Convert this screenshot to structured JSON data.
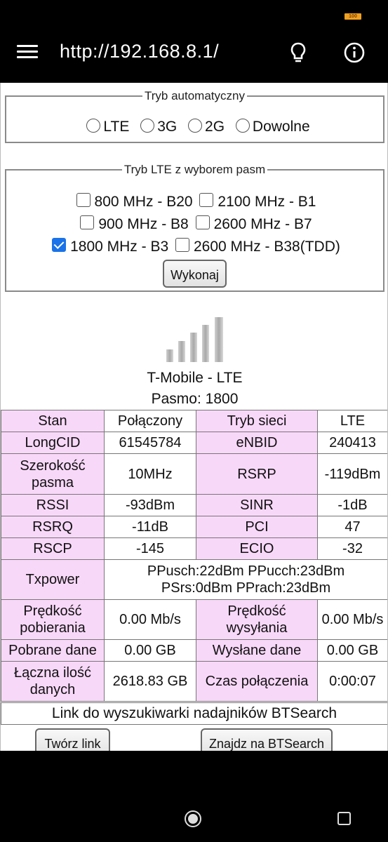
{
  "status_bar": {
    "battery_label": "100"
  },
  "toolbar": {
    "url": "http://192.168.8.1/",
    "menu_icon": "hamburger-menu-icon",
    "bulb_icon": "lightbulb-icon",
    "info_icon": "info-icon"
  },
  "auto_mode": {
    "legend": "Tryb automatyczny",
    "options": [
      "LTE",
      "3G",
      "2G",
      "Dowolne"
    ]
  },
  "lte_bands": {
    "legend": "Tryb LTE z wyborem pasm",
    "rows": [
      [
        {
          "label": "800 MHz - B20",
          "checked": false
        },
        {
          "label": "2100 MHz - B1",
          "checked": false
        }
      ],
      [
        {
          "label": "900 MHz - B8",
          "checked": false
        },
        {
          "label": "2600 MHz - B7",
          "checked": false
        }
      ],
      [
        {
          "label": "1800 MHz - B3",
          "checked": true
        },
        {
          "label": "2600 MHz - B38(TDD)",
          "checked": false
        }
      ]
    ],
    "execute_label": "Wykonaj"
  },
  "signal": {
    "icon": "signal-strength-icon",
    "carrier": "T-Mobile - LTE",
    "band": "Pasmo: 1800"
  },
  "stats": {
    "stan_label": "Stan",
    "stan": "Połączony",
    "tryb_label": "Tryb sieci",
    "tryb": "LTE",
    "longcid_label": "LongCID",
    "longcid": "61545784",
    "enbid_label": "eNBID",
    "enbid": "240413",
    "szer_label_1": "Szerokość",
    "szer_label_2": "pasma",
    "szer": "10MHz",
    "rsrp_label": "RSRP",
    "rsrp": "-119dBm",
    "rssi_label": "RSSI",
    "rssi": "-93dBm",
    "sinr_label": "SINR",
    "sinr": "-1dB",
    "rsrq_label": "RSRQ",
    "rsrq": "-11dB",
    "pci_label": "PCI",
    "pci": "47",
    "rscp_label": "RSCP",
    "rscp": "-145",
    "ecio_label": "ECIO",
    "ecio": "-32",
    "tx_label": "Txpower",
    "tx_line1": "PPusch:22dBm PPucch:23dBm",
    "tx_line2": "PSrs:0dBm PPrach:23dBm",
    "dl_label_1": "Prędkość",
    "dl_label_2": "pobierania",
    "dl": "0.00 Mb/s",
    "ul_label_1": "Prędkość",
    "ul_label_2": "wysyłania",
    "ul": "0.00 Mb/s",
    "down_label": "Pobrane dane",
    "down": "0.00 GB",
    "up_label": "Wysłane dane",
    "up": "0.00 GB",
    "total_label_1": "Łączna ilość",
    "total_label_2": "danych",
    "total": "2618.83 GB",
    "time_label": "Czas połączenia",
    "time": "0:00:07"
  },
  "btsearch": {
    "title": "Link do wyszukiwarki nadajników BTSearch",
    "create_label": "Twórz link",
    "find_label": "Znajdz na BTSearch"
  },
  "nav": {
    "home_icon": "home-icon",
    "rotate_icon": "rotate-icon"
  }
}
